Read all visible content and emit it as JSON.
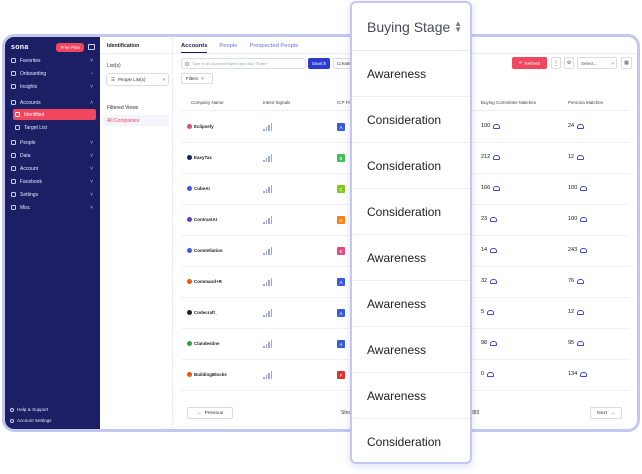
{
  "sidebar": {
    "logo": "sona",
    "plan_badge": "Free Plan",
    "items": [
      {
        "label": "Favorites",
        "chev": "˅"
      },
      {
        "label": "Onboarding",
        "chev": "◔"
      },
      {
        "label": "Insights",
        "chev": "˅"
      },
      {
        "label": "Accounts",
        "chev": "˄"
      },
      {
        "label": "Identified",
        "chev": ""
      },
      {
        "label": "Target List",
        "chev": ""
      },
      {
        "label": "People",
        "chev": "˅"
      },
      {
        "label": "Data",
        "chev": "˅"
      },
      {
        "label": "Account",
        "chev": "˅"
      },
      {
        "label": "Facebook",
        "chev": "˅"
      },
      {
        "label": "Settings",
        "chev": "˅"
      },
      {
        "label": "Misc",
        "chev": "˅"
      }
    ],
    "help": "Help & Support",
    "account_settings": "Account Settings"
  },
  "panel": {
    "title": "Identification",
    "lists_label": "List(s)",
    "lists_select": "People List(s)",
    "filtered_views": "Filtered Views",
    "all_companies": "All Companies"
  },
  "main": {
    "tabs": [
      "Accounts",
      "People",
      "Prospected People"
    ],
    "search_placeholder": "Type in an Account Name and click \"Enter\"",
    "search_btn": "Search",
    "c_btn": "Create",
    "filters": "Filters",
    "refresh": "Refresh",
    "select_placeholder": "Select...",
    "columns": [
      "Company Name",
      "Intent Signals",
      "ICP Fit",
      "Buying Committee Matches",
      "Persona Matches"
    ],
    "rows": [
      {
        "name": "Eclipsefy",
        "fit": "A",
        "bcm": "100",
        "pm": "24"
      },
      {
        "name": "EasyTax",
        "fit": "B",
        "bcm": "212",
        "pm": "12"
      },
      {
        "name": "CubeAI",
        "fit": "C",
        "bcm": "166",
        "pm": "100"
      },
      {
        "name": "ContrastAI",
        "fit": "D",
        "bcm": "23",
        "pm": "100"
      },
      {
        "name": "Constellation",
        "fit": "E",
        "bcm": "14",
        "pm": "243"
      },
      {
        "name": "Command+R",
        "fit": "A",
        "bcm": "32",
        "pm": "76"
      },
      {
        "name": "Codecraft_",
        "fit": "A",
        "bcm": "5",
        "pm": "12"
      },
      {
        "name": "Clandestine",
        "fit": "A",
        "bcm": "98",
        "pm": "95"
      },
      {
        "name": "BuildingBlocks",
        "fit": "F",
        "bcm": "0",
        "pm": "134"
      }
    ],
    "prev": "Previous",
    "next": "Next",
    "show_prefix": "Show",
    "count_suffix": "383"
  },
  "dropdown": {
    "header": "Buying Stage",
    "options": [
      "Awareness",
      "Consideration",
      "Consideration",
      "Consideration",
      "Awareness",
      "Awareness",
      "Awareness",
      "Awareness",
      "Consideration"
    ]
  },
  "colors": {
    "sidebar_bg": "#1c1f63",
    "accent": "#f0475e",
    "primary": "#2b3bd1",
    "fit_A": "#3b5bdb",
    "fit_B": "#40c057",
    "fit_C": "#82c91e",
    "fit_D": "#fd7e14",
    "fit_E": "#e64980",
    "fit_F": "#e03131"
  }
}
